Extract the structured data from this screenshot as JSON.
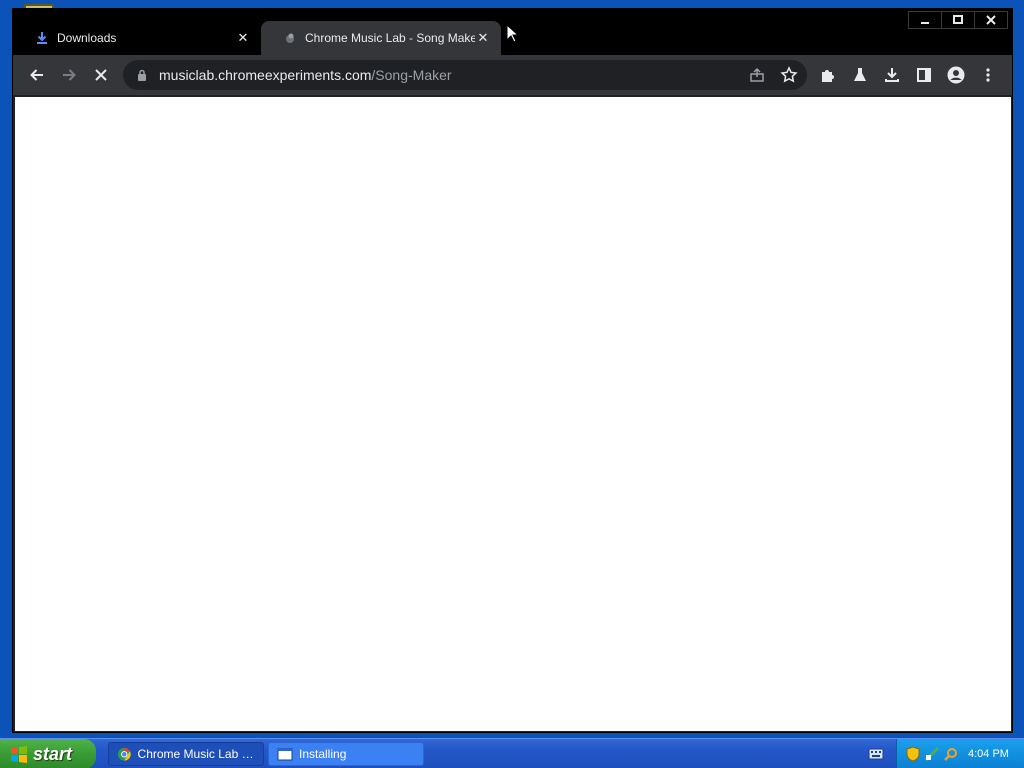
{
  "browser": {
    "tabs": [
      {
        "title": "Downloads",
        "icon": "download-icon",
        "active": false
      },
      {
        "title": "Chrome Music Lab - Song Maker",
        "icon": "music-lab-icon",
        "active": true
      }
    ],
    "url_host": "musiclab.chromeexperiments.com",
    "url_path": "/Song-Maker",
    "loading": true
  },
  "taskbar": {
    "start_label": "start",
    "items": [
      {
        "label": "Chrome Music Lab - S...",
        "icon": "chrome-icon"
      },
      {
        "label": "Installing",
        "icon": "window-icon"
      }
    ],
    "clock": "4:04 PM"
  },
  "colors": {
    "desktop": "#0b53b8",
    "titlebar": "#000000",
    "toolbar": "#35363a",
    "omnibox": "#202124",
    "taskbar": "#245ccc",
    "start_button": "#3a9c34",
    "tray": "#1290e0"
  }
}
